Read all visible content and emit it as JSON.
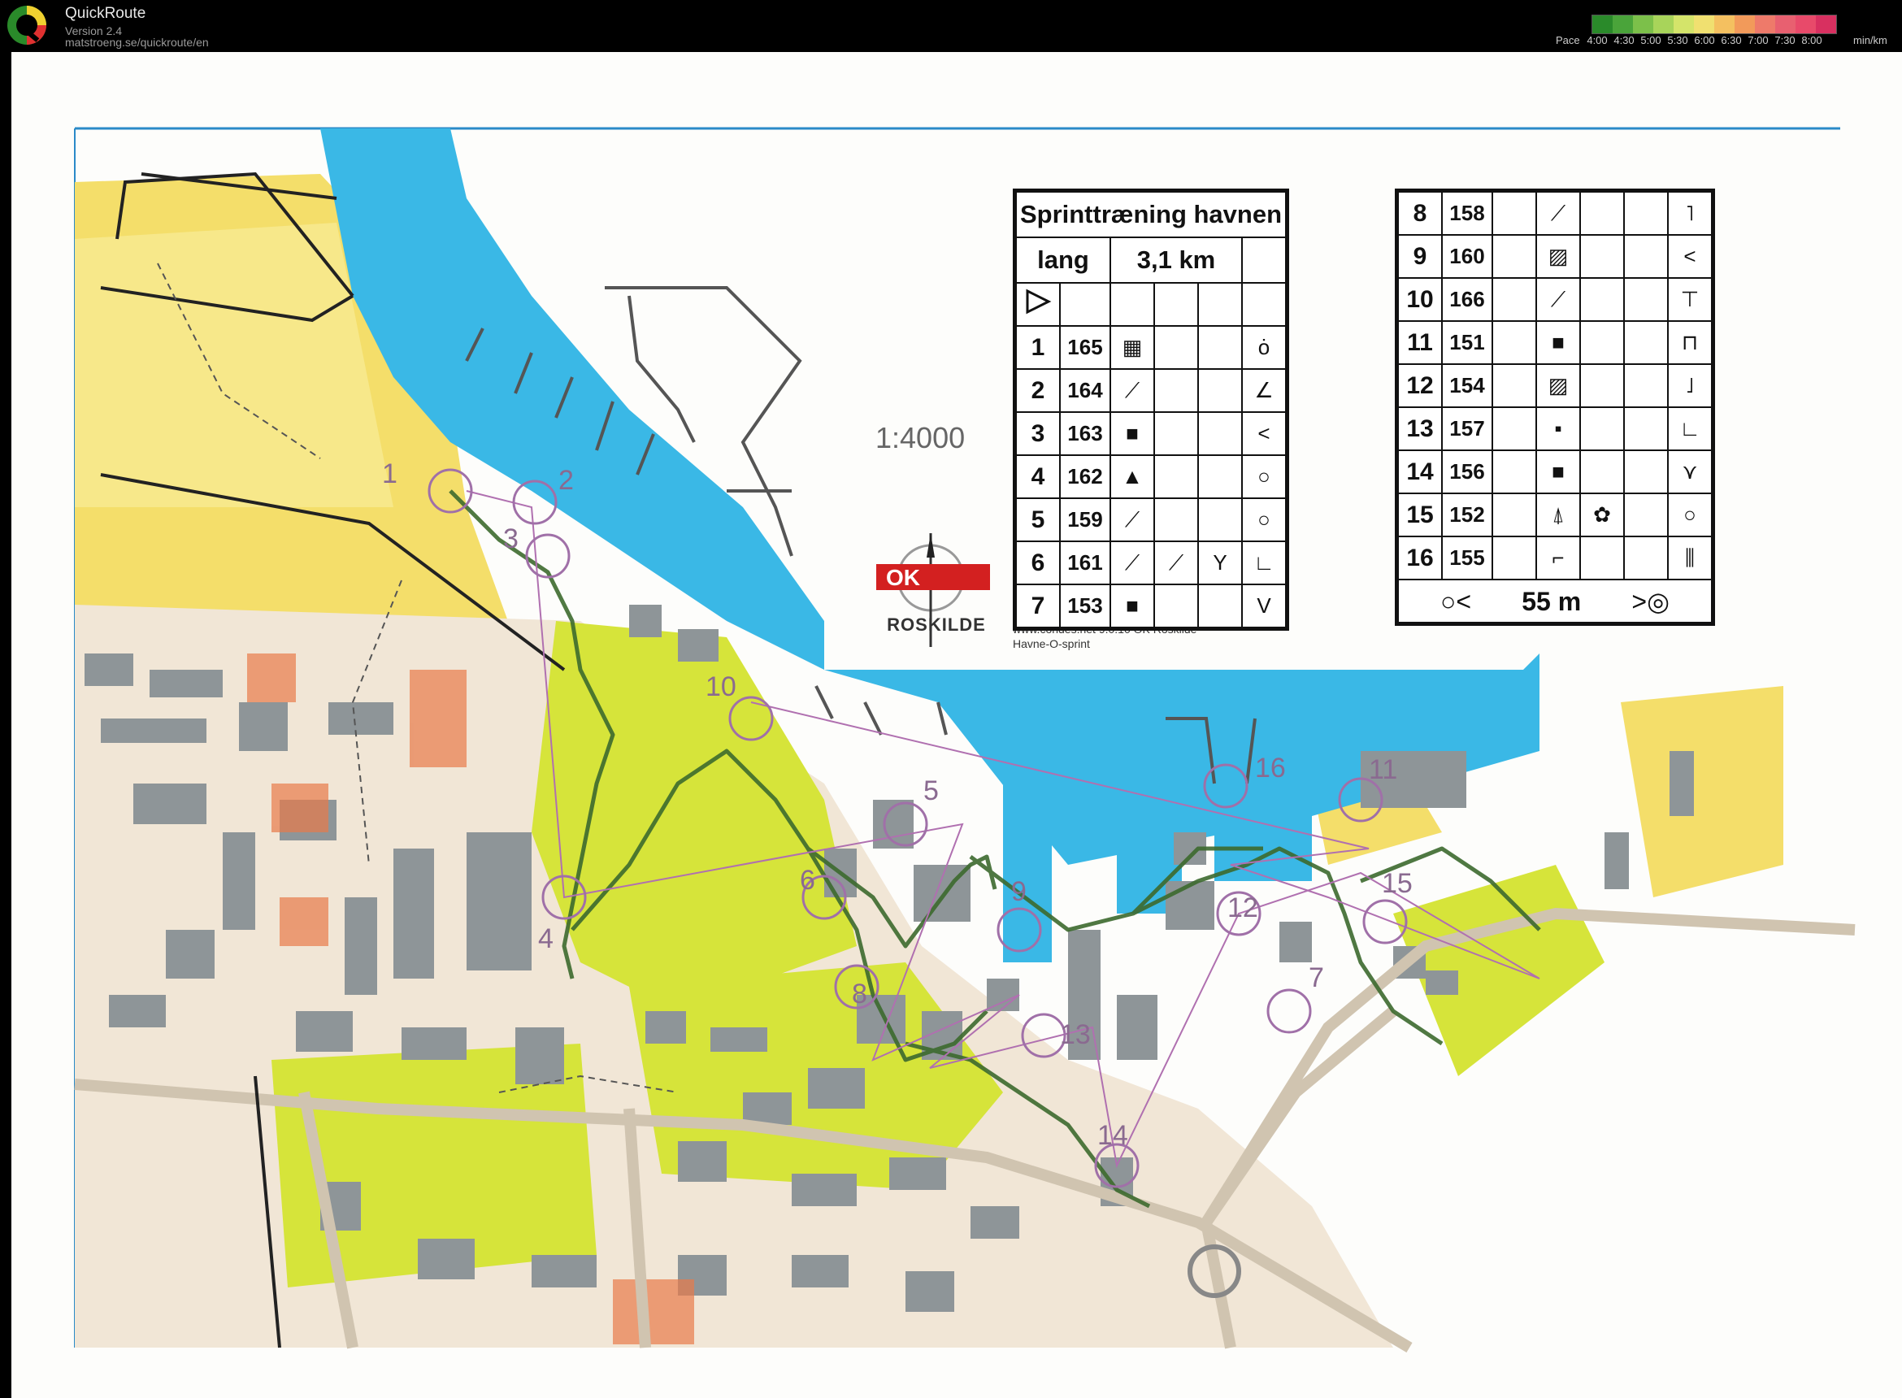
{
  "app": {
    "title": "QuickRoute",
    "version": "Version 2.4",
    "url": "matstroeng.se/quickroute/en"
  },
  "pace_legend": {
    "label": "Pace",
    "ticks": [
      "4:00",
      "4:30",
      "5:00",
      "5:30",
      "6:00",
      "6:30",
      "7:00",
      "7:30",
      "8:00"
    ],
    "unit": "min/km",
    "colors": [
      "#2a8a2a",
      "#4aa43a",
      "#7cc04a",
      "#a8d45a",
      "#d4e46a",
      "#f0e070",
      "#f4c060",
      "#f29a5a",
      "#ee7a6a",
      "#e86070",
      "#e84a6a",
      "#d83060"
    ]
  },
  "map": {
    "scale": "1:4000",
    "club_name": "ROSKILDE",
    "credit_line1": "www.condes.net 9.0.10 OK Roskilde",
    "credit_line2": "Havne-O-sprint",
    "controls": [
      {
        "label": "1"
      },
      {
        "label": "2"
      },
      {
        "label": "3"
      },
      {
        "label": "4"
      },
      {
        "label": "5"
      },
      {
        "label": "6"
      },
      {
        "label": "7"
      },
      {
        "label": "8"
      },
      {
        "label": "9"
      },
      {
        "label": "10"
      },
      {
        "label": "11"
      },
      {
        "label": "12"
      },
      {
        "label": "13"
      },
      {
        "label": "14"
      },
      {
        "label": "15"
      },
      {
        "label": "16"
      }
    ],
    "colors": {
      "water": "#3ab8e6",
      "open_land": "#fbe98a",
      "rough_open": "#f6f08a",
      "forest_green": "#d6e43a",
      "building": "#8e9598",
      "paved": "#f1e6d6",
      "route": "#3d6a2e",
      "course": "#b070b0"
    }
  },
  "descriptions_left": {
    "title": "Sprinttræning havnen",
    "class": "lang",
    "length": "3,1 km",
    "rows": [
      {
        "num": "1",
        "code": "165"
      },
      {
        "num": "2",
        "code": "164"
      },
      {
        "num": "3",
        "code": "163"
      },
      {
        "num": "4",
        "code": "162"
      },
      {
        "num": "5",
        "code": "159"
      },
      {
        "num": "6",
        "code": "161"
      },
      {
        "num": "7",
        "code": "153"
      }
    ]
  },
  "descriptions_right": {
    "rows": [
      {
        "num": "8",
        "code": "158"
      },
      {
        "num": "9",
        "code": "160"
      },
      {
        "num": "10",
        "code": "166"
      },
      {
        "num": "11",
        "code": "151"
      },
      {
        "num": "12",
        "code": "154"
      },
      {
        "num": "13",
        "code": "157"
      },
      {
        "num": "14",
        "code": "156"
      },
      {
        "num": "15",
        "code": "152"
      },
      {
        "num": "16",
        "code": "155"
      }
    ],
    "finish_distance": "55 m"
  }
}
